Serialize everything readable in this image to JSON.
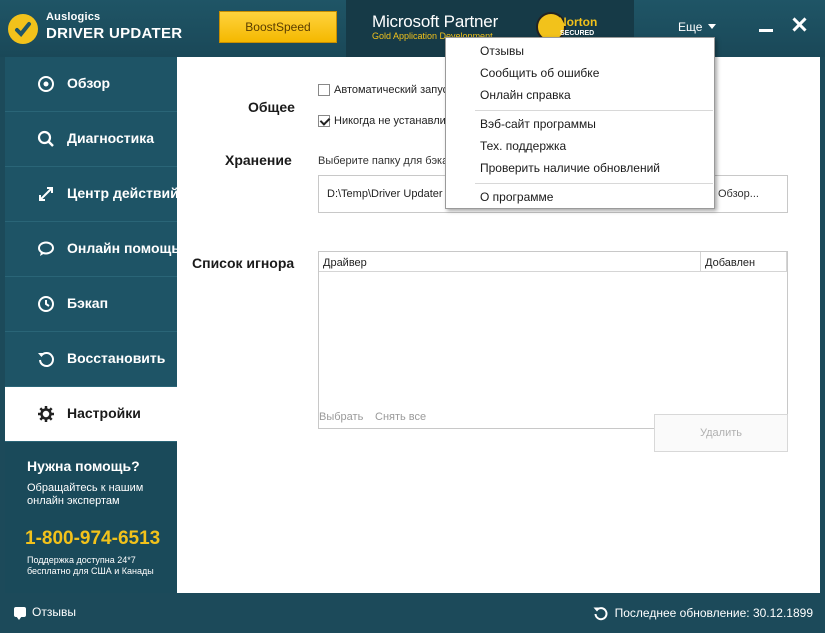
{
  "app": {
    "brand": "Auslogics",
    "name": "DRIVER UPDATER"
  },
  "header": {
    "boost_label": "BoostSpeed",
    "partner_title": "Microsoft Partner",
    "partner_sub": "Gold Application Development",
    "norton_name": "Norton",
    "norton_sub": "SECURED",
    "more_label": "Еще"
  },
  "sidebar": {
    "items": [
      {
        "label": "Обзор",
        "icon": "overview-icon"
      },
      {
        "label": "Диагностика",
        "icon": "search-icon"
      },
      {
        "label": "Центр действий",
        "icon": "action-center-icon"
      },
      {
        "label": "Онлайн помощь",
        "icon": "chat-icon"
      },
      {
        "label": "Бэкап",
        "icon": "backup-icon"
      },
      {
        "label": "Восстановить",
        "icon": "restore-icon"
      },
      {
        "label": "Настройки",
        "icon": "gear-icon",
        "active": true
      }
    ]
  },
  "help": {
    "title": "Нужна помощь?",
    "subtitle": "Обращайтесь к нашим онлайн экспертам",
    "phone": "1-800-974-6513",
    "note": "Поддержка доступна 24*7 бесплатно для США и Канады"
  },
  "settings": {
    "general_label": "Общее",
    "auto_start_label": "Автоматический запуск",
    "never_install_label": "Никогда не устанавливать",
    "auto_start_checked": false,
    "never_install_checked": true,
    "storage_label": "Хранение",
    "storage_hint": "Выберите папку для бэкапа",
    "storage_path": "D:\\Temp\\Driver Updater",
    "browse_label": "Обзор...",
    "ignore_label": "Список игнора",
    "col_driver": "Драйвер",
    "col_added": "Добавлен",
    "select_label": "Выбрать",
    "deselect_label": "Снять все",
    "delete_label": "Удалить"
  },
  "menu": {
    "items": [
      "Отзывы",
      "Сообщить об ошибке",
      "Онлайн справка",
      "Вэб-сайт программы",
      "Тех. поддержка",
      "Проверить наличие обновлений",
      "О программе"
    ]
  },
  "status": {
    "feedback_label": "Отзывы",
    "last_update": "Последнее обновление: 30.12.1899"
  },
  "colors": {
    "sidebar_bg": "#1e5466",
    "accent_yellow": "#f2c21b",
    "active_bg": "#ffffff"
  }
}
